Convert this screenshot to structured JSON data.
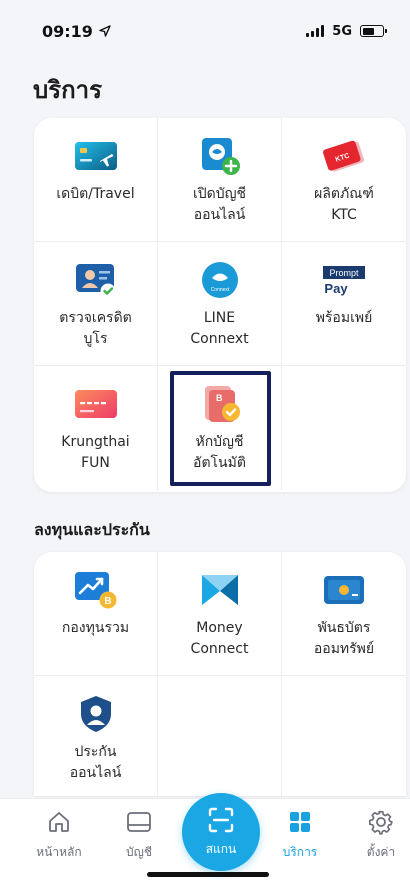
{
  "status": {
    "time": "09:19",
    "network": "5G"
  },
  "page_title": "บริการ",
  "services": [
    {
      "label": "เดบิต/Travel",
      "icon": "travel-card-icon"
    },
    {
      "label": "เปิดบัญชี\nออนไลน์",
      "icon": "open-account-icon"
    },
    {
      "label": "ผลิตภัณฑ์\nKTC",
      "icon": "ktc-card-icon",
      "badge": "KTC"
    },
    {
      "label": "ตรวจเครดิต\nบูโร",
      "icon": "credit-bureau-icon"
    },
    {
      "label": "LINE\nConnext",
      "icon": "line-connext-icon",
      "badge": "Connext"
    },
    {
      "label": "พร้อมเพย์",
      "icon": "promptpay-icon",
      "badge_top": "Prompt",
      "badge_bottom": "Pay"
    },
    {
      "label": "Krungthai\nFUN",
      "icon": "fun-card-icon"
    },
    {
      "label": "หักบัญชี\nอัตโนมัติ",
      "icon": "auto-debit-icon"
    }
  ],
  "invest_title": "ลงทุนและประกัน",
  "invest": [
    {
      "label": "กองทุนรวม",
      "icon": "mutual-fund-icon"
    },
    {
      "label": "Money\nConnect",
      "icon": "money-connect-icon"
    },
    {
      "label": "พันธบัตร\nออมทรัพย์",
      "icon": "savings-bond-icon"
    },
    {
      "label": "ประกัน\nออนไลน์",
      "icon": "insurance-icon"
    }
  ],
  "tabbar": {
    "home": "หน้าหลัก",
    "account": "บัญชี",
    "scan": "สแกน",
    "services": "บริการ",
    "settings": "ตั้งค่า"
  },
  "colors": {
    "accent": "#1ba7e4",
    "highlight": "#14205c"
  }
}
